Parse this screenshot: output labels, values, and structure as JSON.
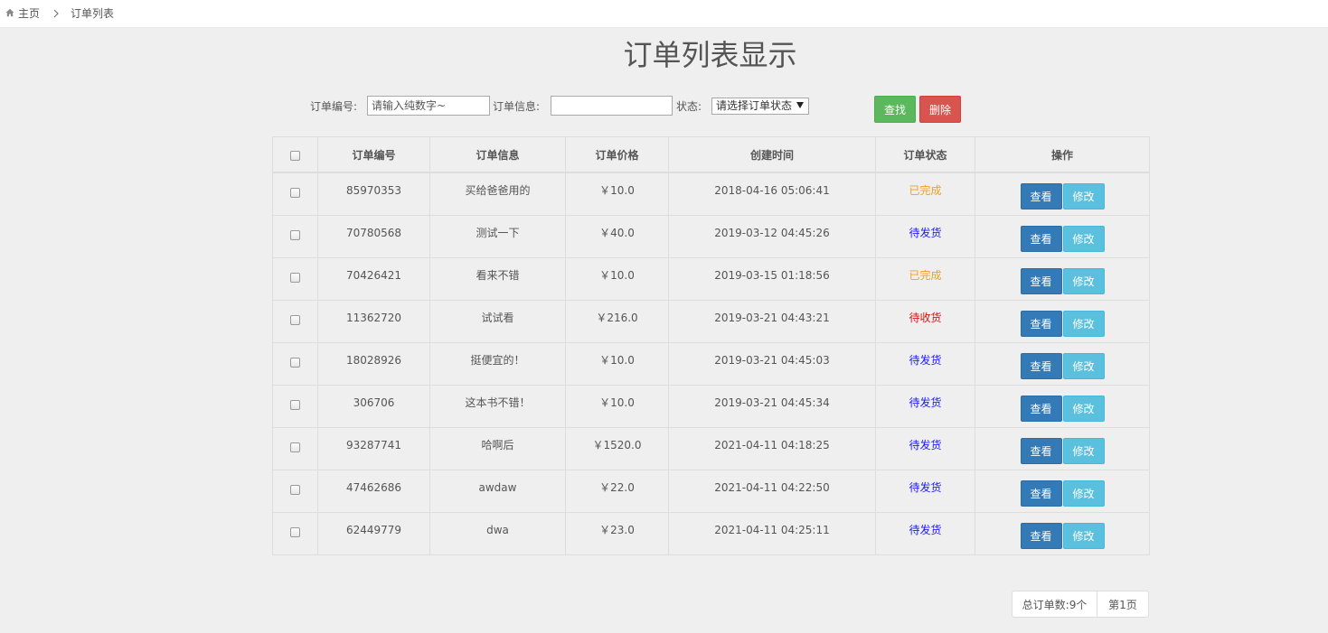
{
  "breadcrumb": {
    "home": "主页",
    "current": "订单列表"
  },
  "page_title": "订单列表显示",
  "search": {
    "order_no_label": "订单编号:",
    "order_no_placeholder": "请输入纯数字~",
    "order_info_label": "订单信息:",
    "order_info_value": "",
    "status_label": "状态:",
    "status_selected": "请选择订单状态",
    "search_button": "查找",
    "delete_button": "删除"
  },
  "table": {
    "headers": [
      "订单编号",
      "订单信息",
      "订单价格",
      "创建时间",
      "订单状态",
      "操作"
    ],
    "view_label": "查看",
    "edit_label": "修改",
    "rows": [
      {
        "no": "85970353",
        "info": "买给爸爸用的",
        "price": "￥10.0",
        "time": "2018-04-16 05:06:41",
        "status": "已完成",
        "status_color": "#f0a020"
      },
      {
        "no": "70780568",
        "info": "测试一下",
        "price": "￥40.0",
        "time": "2019-03-12 04:45:26",
        "status": "待发货",
        "status_color": "#1a1aff"
      },
      {
        "no": "70426421",
        "info": "看来不错",
        "price": "￥10.0",
        "time": "2019-03-15 01:18:56",
        "status": "已完成",
        "status_color": "#f0a020"
      },
      {
        "no": "11362720",
        "info": "试试看",
        "price": "￥216.0",
        "time": "2019-03-21 04:43:21",
        "status": "待收货",
        "status_color": "#e01010"
      },
      {
        "no": "18028926",
        "info": "挺便宜的！",
        "price": "￥10.0",
        "time": "2019-03-21 04:45:03",
        "status": "待发货",
        "status_color": "#1a1aff"
      },
      {
        "no": "306706",
        "info": "这本书不错！",
        "price": "￥10.0",
        "time": "2019-03-21 04:45:34",
        "status": "待发货",
        "status_color": "#1a1aff"
      },
      {
        "no": "93287741",
        "info": "哈啊后",
        "price": "￥1520.0",
        "time": "2021-04-11 04:18:25",
        "status": "待发货",
        "status_color": "#1a1aff"
      },
      {
        "no": "47462686",
        "info": "awdaw",
        "price": "￥22.0",
        "time": "2021-04-11 04:22:50",
        "status": "待发货",
        "status_color": "#1a1aff"
      },
      {
        "no": "62449779",
        "info": "dwa",
        "price": "￥23.0",
        "time": "2021-04-11 04:25:11",
        "status": "待发货",
        "status_color": "#1a1aff"
      }
    ]
  },
  "pager": {
    "total": "总订单数:9个",
    "page": "第1页"
  },
  "colors": {
    "search_button": "#5cb85c",
    "delete_button": "#d9534f",
    "view_button": "#337ab7",
    "edit_button": "#5bc0de"
  }
}
